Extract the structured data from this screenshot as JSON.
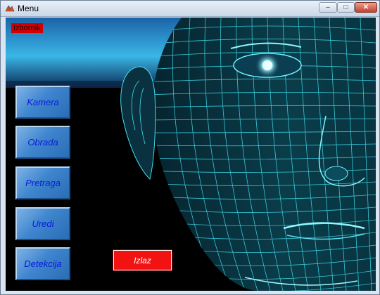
{
  "window": {
    "title": "Menu",
    "icon": "matlab-figure-icon",
    "controls": {
      "minimize": "minimize-icon",
      "maximize": "maximize-icon",
      "close": "close-icon"
    }
  },
  "menu_label": "Izbornik",
  "sidebar": {
    "buttons": [
      {
        "label": "Kamera"
      },
      {
        "label": "Obrada"
      },
      {
        "label": "Pretraga"
      },
      {
        "label": "Uredi"
      },
      {
        "label": "Detekcija"
      }
    ]
  },
  "exit_button": {
    "label": "Izlaz"
  },
  "colors": {
    "button_blue": "#3f86cf",
    "button_text": "#0a1bd8",
    "exit_red": "#f21212",
    "label_red": "#d40000",
    "wireframe_cyan": "#3fe0f0",
    "background": "#000000"
  }
}
